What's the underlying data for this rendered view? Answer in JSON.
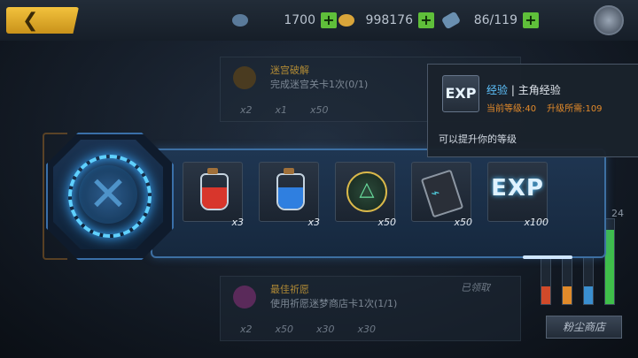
{
  "resources": {
    "stamina": "1700",
    "gold": "998176",
    "tickets": "86/119"
  },
  "quests": [
    {
      "title": "迷宫破解",
      "desc": "完成迷宫关卡1次(0/1)",
      "rewards": [
        "x2",
        "x1",
        "x50"
      ]
    },
    {
      "title": "最佳祈愿",
      "desc": "使用祈愿迷梦商店卡1次(1/1)",
      "rewards": [
        "x2",
        "x50",
        "x30",
        "x30"
      ],
      "status": "已领取"
    }
  ],
  "side_numbers": {
    "top": "24"
  },
  "shop_button": "粉尘商店",
  "rewards": [
    {
      "icon": "red-potion-icon",
      "qty": "x3",
      "color": "#d8362c"
    },
    {
      "icon": "blue-potion-icon",
      "qty": "x3",
      "color": "#2f7fe0"
    },
    {
      "icon": "emblem-token-icon",
      "qty": "x50"
    },
    {
      "icon": "chip-card-icon",
      "qty": "x50"
    },
    {
      "icon": "exp-icon",
      "qty": "x100",
      "label": "EXP"
    }
  ],
  "tooltip": {
    "icon_label": "EXP",
    "category": "经验",
    "separator": " | ",
    "name": "主角经验",
    "current_level": "当前等级:40",
    "required": "升级所需:109",
    "description": "可以提升你的等级"
  }
}
